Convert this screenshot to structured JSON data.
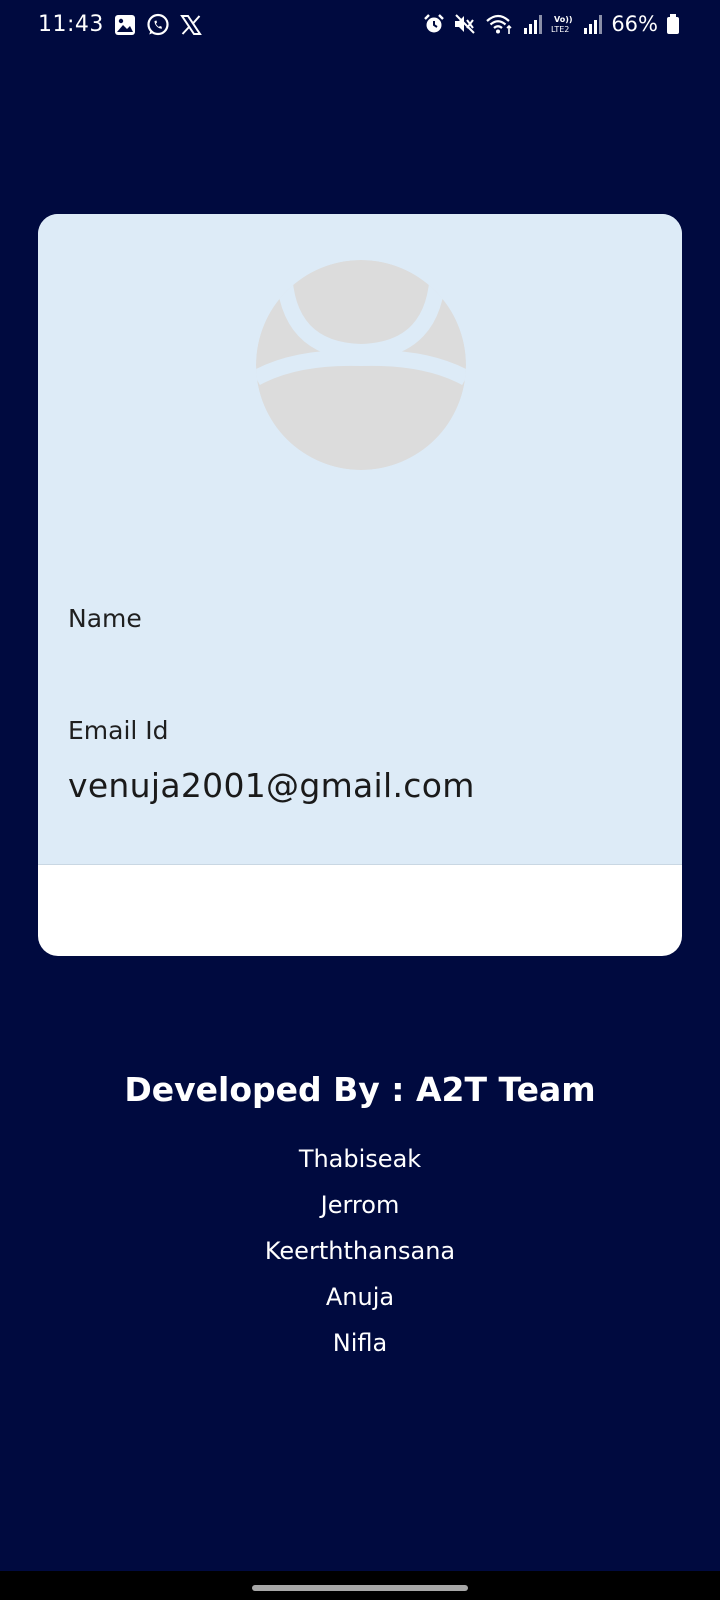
{
  "status_bar": {
    "time": "11:43",
    "battery": "66%",
    "icons_left": [
      "gallery-icon",
      "whatsapp-icon",
      "x-icon"
    ],
    "icons_right": [
      "alarm-icon",
      "mute-icon",
      "wifi-icon",
      "signal-icon",
      "volte-icon",
      "signal-icon",
      "battery-icon"
    ]
  },
  "profile": {
    "name_label": "Name",
    "name_value": "",
    "email_label": "Email Id",
    "email_value": "venuja2001@gmail.com"
  },
  "developers": {
    "heading": "Developed By : A2T Team",
    "members": [
      "Thabiseak",
      "Jerrom",
      "Keerththansana",
      "Anuja",
      "Nifla"
    ]
  },
  "colors": {
    "background": "#000a3f",
    "card_top": "#ddebf7",
    "card_bottom": "#ffffff",
    "avatar_placeholder": "#dcdcdc"
  }
}
